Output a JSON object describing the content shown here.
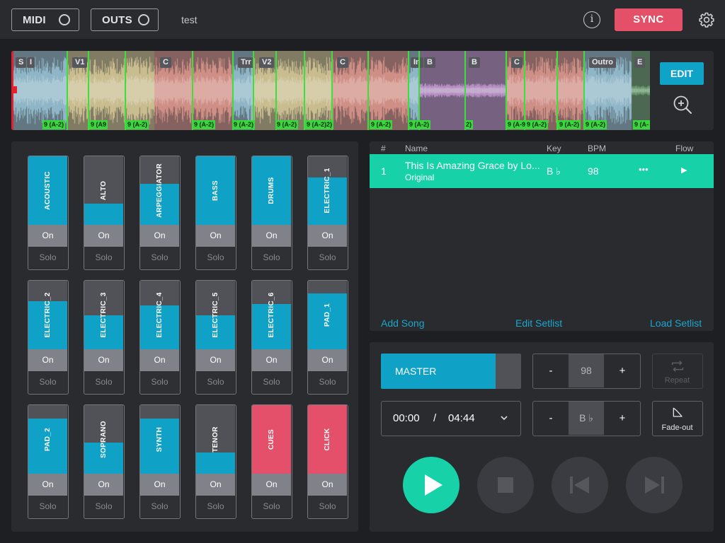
{
  "topbar": {
    "midi_label": "MIDI",
    "outs_label": "OUTS",
    "project_name": "test",
    "info_glyph": "i",
    "sync_label": "SYNC",
    "icons": [
      "info-icon",
      "gear-icon"
    ]
  },
  "waveform": {
    "sections": [
      {
        "label": "S",
        "color": "#8fb6c7"
      },
      {
        "label": "I",
        "color": "#8fb6c7"
      },
      {
        "label": "V1",
        "color": "#c9bd8f"
      },
      {
        "label": "C",
        "color": "#cf8f86"
      },
      {
        "label": "Trr",
        "color": "#8fb6c7"
      },
      {
        "label": "V2",
        "color": "#c9bd8f"
      },
      {
        "label": "C",
        "color": "#cf8f86"
      },
      {
        "label": "In",
        "color": "#8fb6c7"
      },
      {
        "label": "B",
        "color": "#b58fc2"
      },
      {
        "label": "B",
        "color": "#b58fc2"
      },
      {
        "label": "C",
        "color": "#cf8f86"
      },
      {
        "label": "Outro",
        "color": "#8fb6c7"
      },
      {
        "label": "E",
        "color": "#6a9a70"
      }
    ],
    "chord_labels": [
      "9 (A-2)",
      "9 (A9",
      "9 (A-2)",
      "9 (A-2)",
      "9 (A-2)",
      "9 (A-2)",
      "9 (A-2)2)",
      "9 (A-2)",
      "9 (A-2)",
      "2)",
      "9 (A-9",
      "9 (A-2)",
      "9 (A-2)",
      "9 (A-2)",
      "9 (A-"
    ],
    "edit_label": "EDIT",
    "zoom_icon": "zoom-in-icon",
    "playhead_color": "#e2202e",
    "marker_color": "#3be03b"
  },
  "mixer": {
    "on_label": "On",
    "solo_label": "Solo",
    "tracks": [
      {
        "name": "ACOUSTIC",
        "level": 1.0,
        "color": "blue"
      },
      {
        "name": "ALTO",
        "level": 0.31,
        "color": "blue"
      },
      {
        "name": "ARPEGGIATOR",
        "level": 0.6,
        "color": "blue"
      },
      {
        "name": "BASS",
        "level": 1.0,
        "color": "blue"
      },
      {
        "name": "DRUMS",
        "level": 1.0,
        "color": "blue"
      },
      {
        "name": "ELECTRIC_1",
        "level": 0.69,
        "color": "blue"
      },
      {
        "name": "ELECTRIC_2",
        "level": 0.7,
        "color": "blue"
      },
      {
        "name": "ELECTRIC_3",
        "level": 0.49,
        "color": "blue"
      },
      {
        "name": "ELECTRIC_4",
        "level": 0.64,
        "color": "blue"
      },
      {
        "name": "ELECTRIC_5",
        "level": 0.49,
        "color": "blue"
      },
      {
        "name": "ELECTRIC_6",
        "level": 0.66,
        "color": "blue"
      },
      {
        "name": "PAD_1",
        "level": 0.81,
        "color": "blue"
      },
      {
        "name": "PAD_2",
        "level": 0.8,
        "color": "blue"
      },
      {
        "name": "SOPRANO",
        "level": 0.45,
        "color": "blue"
      },
      {
        "name": "SYNTH",
        "level": 0.8,
        "color": "blue"
      },
      {
        "name": "TENOR",
        "level": 0.31,
        "color": "blue"
      },
      {
        "name": "CUES",
        "level": 1.0,
        "color": "red"
      },
      {
        "name": "CLICK",
        "level": 1.0,
        "color": "red"
      }
    ],
    "colors": {
      "blue": "#0fa1c6",
      "red": "#e44f6a"
    }
  },
  "setlist": {
    "columns": {
      "num": "#",
      "name": "Name",
      "key": "Key",
      "bpm": "BPM",
      "flow": "Flow"
    },
    "songs": [
      {
        "num": "1",
        "title": "This Is Amazing Grace by Lo...",
        "subtitle": "Original",
        "key": "B ♭",
        "bpm": "98",
        "more": "•••",
        "play": "▶"
      }
    ],
    "add_song": "Add Song",
    "edit_setlist": "Edit Setlist",
    "load_setlist": "Load Setlist",
    "row_color": "#17d2a9"
  },
  "transport": {
    "master_label": "MASTER",
    "master_level": 0.9,
    "bpm": {
      "minus": "-",
      "value": "98",
      "plus": "+"
    },
    "key": {
      "minus": "-",
      "value": "B ♭",
      "plus": "+"
    },
    "time_current": "00:00",
    "time_sep": "/",
    "time_total": "04:44",
    "repeat_label": "Repeat",
    "fadeout_label": "Fade-out",
    "accent": "#17d2a9"
  }
}
